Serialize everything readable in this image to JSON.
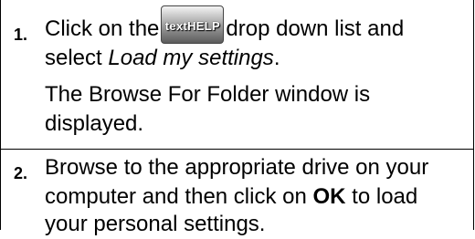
{
  "steps": [
    {
      "number": "1.",
      "line1_before": "Click on the",
      "button_label": "textHELP",
      "line1_after": "drop down list and",
      "line2_before": "select",
      "line2_italic": "Load my settings",
      "line2_after": ".",
      "note_line1": "The Browse For Folder window is",
      "note_line2": "displayed."
    },
    {
      "number": "2.",
      "line1": "Browse to the appropriate drive on your",
      "line2_before": "computer and then click on",
      "line2_bold": "OK",
      "line2_after": "to load",
      "line3": "your personal settings."
    }
  ]
}
